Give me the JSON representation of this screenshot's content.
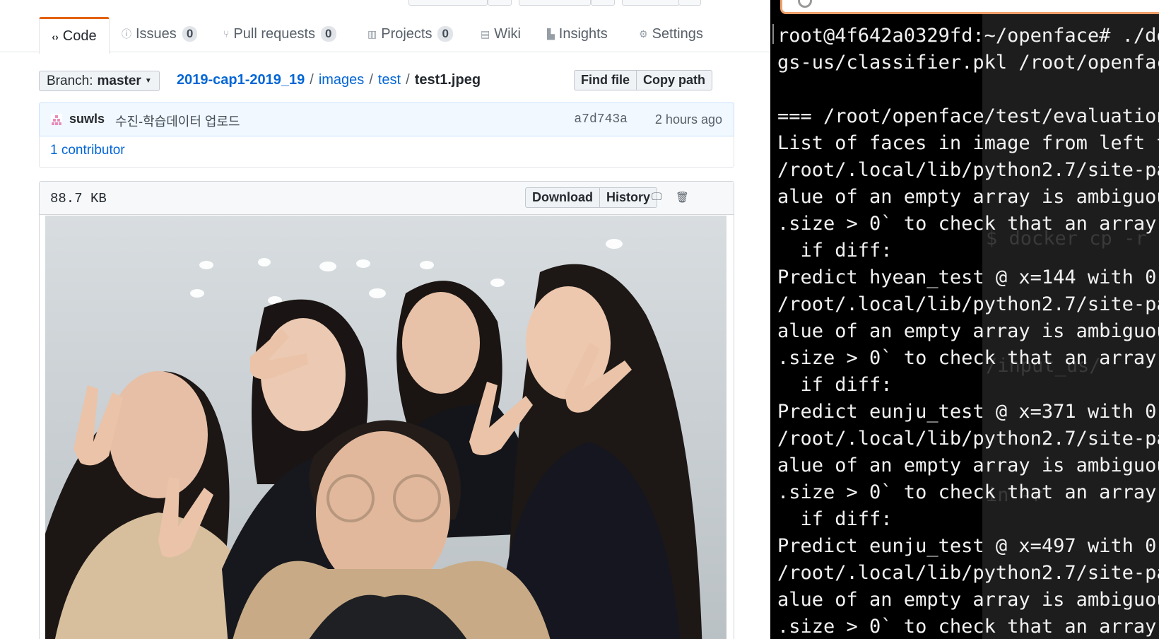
{
  "repo_tabs": [
    {
      "label": "Code",
      "icon": "code-icon",
      "count": ""
    },
    {
      "label": "Issues",
      "icon": "issue-icon",
      "count": "0"
    },
    {
      "label": "Pull requests",
      "icon": "pull-request-icon",
      "count": "0"
    },
    {
      "label": "Projects",
      "icon": "project-icon",
      "count": "0"
    },
    {
      "label": "Wiki",
      "icon": "book-icon",
      "count": ""
    },
    {
      "label": "Insights",
      "icon": "graph-icon",
      "count": ""
    },
    {
      "label": "Settings",
      "icon": "gear-icon",
      "count": ""
    }
  ],
  "branch": {
    "prefix": "Branch:",
    "name": "master"
  },
  "breadcrumb": {
    "repo": "2019-cap1-2019_19",
    "sep": "/",
    "parts": [
      "images",
      "test"
    ],
    "file": "test1.jpeg"
  },
  "file_actions": {
    "find": "Find file",
    "copy": "Copy path"
  },
  "commit": {
    "author": "suwls",
    "message": "수진-학습데이터 업로드",
    "sha": "a7d743a",
    "time": "2 hours ago"
  },
  "contributors": "1 contributor",
  "file": {
    "size": "88.7 KB",
    "download": "Download",
    "history": "History"
  },
  "terminal": {
    "lines": [
      "root@4f642a0329fd:~/openface# ./de",
      "gs-us/classifier.pkl /root/openfac",
      "",
      "=== /root/openface/test/evaluation",
      "List of faces in image from left t",
      "/root/.local/lib/python2.7/site-pa",
      "alue of an empty array is ambiguou",
      ".size > 0` to check that an array ",
      "  if diff:",
      "Predict hyean_test @ x=144 with 0.",
      "/root/.local/lib/python2.7/site-pa",
      "alue of an empty array is ambiguou",
      ".size > 0` to check that an array ",
      "  if diff:",
      "Predict eunju_test @ x=371 with 0.",
      "/root/.local/lib/python2.7/site-pa",
      "alue of an empty array is ambiguou",
      ".size > 0` to check that an array ",
      "  if diff:",
      "Predict eunju_test @ x=497 with 0.",
      "/root/.local/lib/python2.7/site-pa",
      "alue of an empty array is ambiguou",
      ".size > 0` to check that an array "
    ],
    "background_window_text": [
      "$ docker cp -r",
      "/input_us/",
      "in -r"
    ]
  },
  "colors": {
    "accent_tab": "#e36209",
    "link": "#0366d6",
    "terminal_bg": "#000000",
    "search_outline": "#f0a06a"
  }
}
